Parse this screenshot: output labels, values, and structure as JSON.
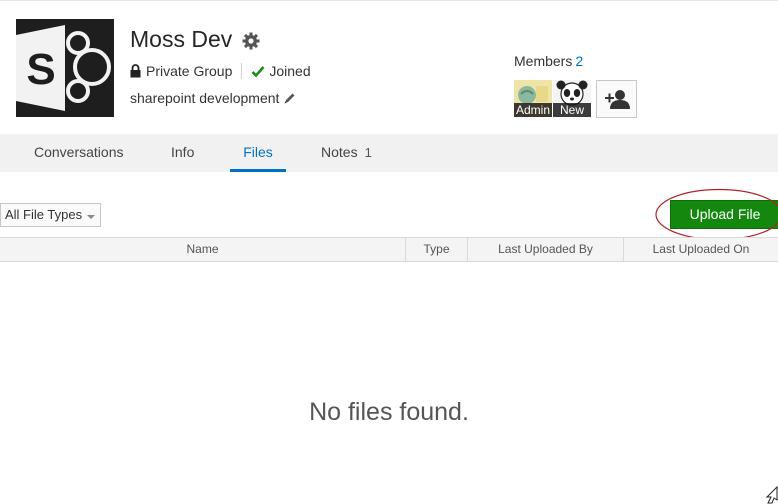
{
  "group": {
    "title": "Moss Dev",
    "logo_letter": "S",
    "privacy": "Private Group",
    "membership_status": "Joined",
    "description": "sharepoint development"
  },
  "members": {
    "label": "Members",
    "count": "2",
    "people": [
      {
        "name": "Admin"
      },
      {
        "name": "New"
      }
    ]
  },
  "tabs": [
    {
      "label": "Conversations"
    },
    {
      "label": "Info"
    },
    {
      "label": "Files",
      "active": true
    },
    {
      "label": "Notes",
      "count": "1"
    }
  ],
  "files": {
    "filter": {
      "selected": "All File Types"
    },
    "upload_label": "Upload File",
    "columns": [
      "Name",
      "Type",
      "Last Uploaded By",
      "Last Uploaded On"
    ],
    "empty_message": "No files found."
  },
  "colors": {
    "accent": "#0072c6",
    "upload_button": "#14870f",
    "annotation": "#b0212a",
    "logo_bg": "#1e1e1e"
  },
  "icons": [
    "gear-icon",
    "lock-icon",
    "check-icon",
    "pencil-icon",
    "add-person-icon",
    "caret-down-icon"
  ]
}
